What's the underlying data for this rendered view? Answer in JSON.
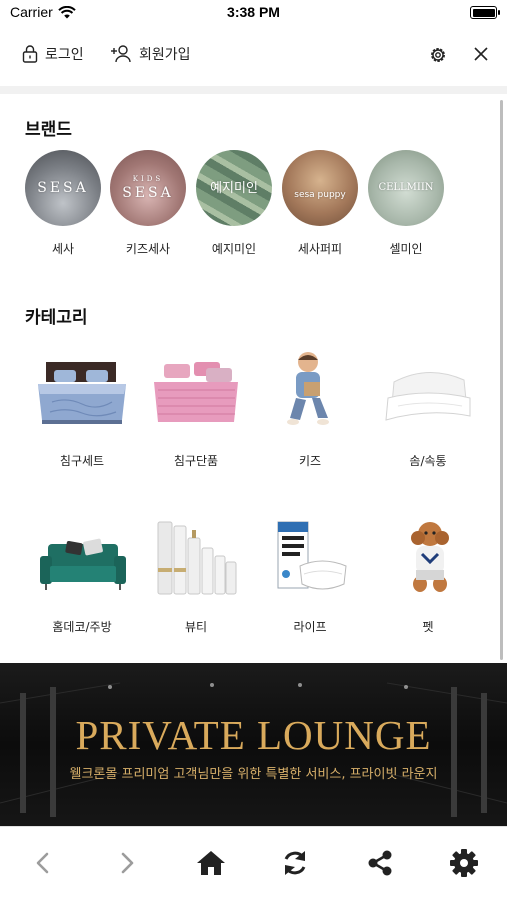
{
  "status_bar": {
    "carrier": "Carrier",
    "time": "3:38 PM"
  },
  "top_nav": {
    "login_label": "로그인",
    "signup_label": "회원가입"
  },
  "brand_section": {
    "title": "브랜드",
    "brands": [
      {
        "name": "세사",
        "logo": "SESA"
      },
      {
        "name": "키즈세사",
        "logo_small": "KIDS",
        "logo": "SESA"
      },
      {
        "name": "예지미인",
        "logo": "예지미인"
      },
      {
        "name": "세사퍼피",
        "logo": "sesa puppy"
      },
      {
        "name": "셀미인",
        "logo": "CELLMIIN"
      }
    ]
  },
  "category_section": {
    "title": "카테고리",
    "categories": [
      {
        "name": "침구세트",
        "icon": "bedding-set-image"
      },
      {
        "name": "침구단품",
        "icon": "bedding-single-image"
      },
      {
        "name": "키즈",
        "icon": "kids-image"
      },
      {
        "name": "솜/속통",
        "icon": "pillow-filling-image"
      },
      {
        "name": "홈데코/주방",
        "icon": "sofa-image"
      },
      {
        "name": "뷰티",
        "icon": "cosmetics-image"
      },
      {
        "name": "라이프",
        "icon": "mask-image"
      },
      {
        "name": "펫",
        "icon": "dog-image"
      }
    ]
  },
  "banner": {
    "title": "PRIVATE LOUNGE",
    "subtitle": "웰크론몰 프리미엄 고객님만을 위한 특별한 서비스, 프라이빗 라운지"
  },
  "colors": {
    "gold": "#d9aa5c",
    "banner_bg": "#111111",
    "divider": "#f1f1f1"
  },
  "bottom_bar": {
    "icons": [
      "back-icon",
      "forward-icon",
      "home-icon",
      "refresh-icon",
      "share-icon",
      "settings-icon"
    ]
  }
}
